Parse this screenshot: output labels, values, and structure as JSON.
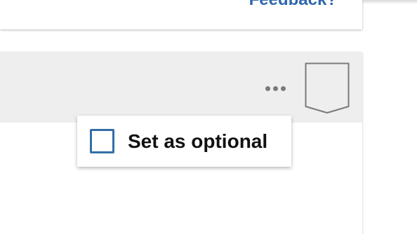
{
  "top_card": {
    "feedback_label": "Feedback?"
  },
  "card": {
    "more_icon": "more-horizontal-icon",
    "bookmark_icon": "bookmark-badge-icon"
  },
  "menu": {
    "items": [
      {
        "label": "Set as optional",
        "checked": false
      }
    ]
  },
  "colors": {
    "link": "#2f67ad",
    "checkbox_border": "#336ea6",
    "header_band": "#eeeeee",
    "icon_gray": "#7a7a7a"
  }
}
